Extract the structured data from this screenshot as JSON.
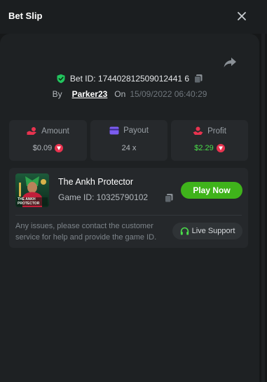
{
  "header": {
    "title": "Bet Slip"
  },
  "bet": {
    "id_text": "Bet ID: 174402812509012441 6",
    "by_label": "By",
    "user": "Parker23",
    "on_label": "On",
    "datetime": "15/09/2022 06:40:29"
  },
  "stats": {
    "amount": {
      "label": "Amount",
      "value": "$0.09"
    },
    "payout": {
      "label": "Payout",
      "value": "24 x"
    },
    "profit": {
      "label": "Profit",
      "value": "$2.29"
    }
  },
  "game": {
    "name": "The Ankh Protector",
    "id_text": "Game ID: 10325790102",
    "thumb_text": "THE ANKH PROTECTOR",
    "play_label": "Play Now"
  },
  "support": {
    "notice": "Any issues, please contact the customer service for help and provide the game ID.",
    "live_label": "Live Support"
  },
  "icons": {
    "close": "close-icon",
    "share": "share-icon",
    "shield": "shield-check-icon",
    "copy": "copy-icon",
    "amount": "hand-coin-icon",
    "payout": "card-icon",
    "profit": "profit-hand-icon",
    "coin": "coin-icon",
    "headset": "headset-icon"
  },
  "colors": {
    "accent_green": "#3fb31b",
    "profit_green": "#4ade4a",
    "amount_icon": "#e8334f",
    "payout_icon": "#7b5cf0",
    "profit_icon": "#e8334f"
  }
}
